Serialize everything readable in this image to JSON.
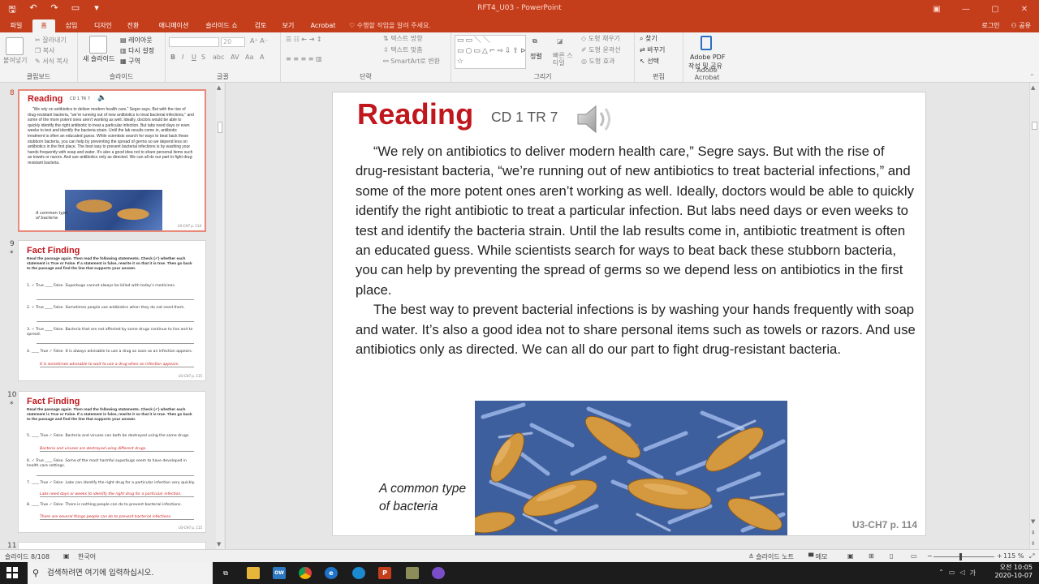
{
  "window": {
    "title": "RFT4_U03 - PowerPoint",
    "login": "로그인",
    "share": "공유"
  },
  "tabs": [
    "파일",
    "홈",
    "삽입",
    "디자인",
    "전환",
    "애니메이션",
    "슬라이드 쇼",
    "검토",
    "보기",
    "Acrobat"
  ],
  "tell_me": "수행할 작업을 알려 주세요.",
  "ribbon": {
    "clipboard": {
      "label": "클립보드",
      "paste": "붙여넣기",
      "cut": "잘라내기",
      "copy": "복사",
      "format_painter": "서식 복사"
    },
    "slides": {
      "label": "슬라이드",
      "new_slide": "새 슬라이드",
      "layout": "레이아웃",
      "reset": "다시 설정",
      "section": "구역"
    },
    "font": {
      "label": "글꼴",
      "size": "20"
    },
    "paragraph": {
      "label": "단락",
      "text_direction": "텍스트 방향",
      "align_text": "텍스트 맞춤",
      "smartart": "SmartArt로 변환"
    },
    "drawing": {
      "label": "그리기",
      "arrange": "정렬",
      "quick_styles": "빠른 스타일",
      "fill": "도형 채우기",
      "outline": "도형 윤곽선",
      "effects": "도형 효과"
    },
    "editing": {
      "label": "편집",
      "find": "찾기",
      "replace": "바꾸기",
      "select": "선택"
    },
    "acrobat": {
      "label": "Adobe Acrobat",
      "create_share_1": "Adobe PDF",
      "create_share_2": "작성 및 공유"
    }
  },
  "thumbnails": [
    {
      "number": "8",
      "title": "Reading",
      "cd": "CD 1 TR 7",
      "text": "“We rely on antibiotics to deliver modern health care,” Segre says. But with the rise of drug-resistant bacteria, “we’re running out of new antibiotics to treat bacterial infections,” and some of the more potent ones aren’t working as well. Ideally, doctors would be able to quickly identify the right antibiotic to treat a particular infection. But labs need days or even weeks to test and identify the bacteria strain. Until the lab results come in, antibiotic treatment is often an educated guess. While scientists search for ways to beat back these stubborn bacteria, you can help by preventing the spread of germs so we depend less on antibiotics in the first place. The best way to prevent bacterial infections is by washing your hands frequently with soap and water. It’s also a good idea not to share personal items such as towels or razors. And use antibiotics only as directed. We can all do our part to fight drug-resistant bacteria.",
      "caption": "A common type of bacteria",
      "page": "U3-CH7 p. 114"
    },
    {
      "number": "9",
      "title": "Fact Finding",
      "instructions": "Read the passage again. Then read the following statements. Check (✓) whether each statement is True or False. If a statement is false, rewrite it so that it is true. Then go back to the passage and find the line that supports your answer.",
      "items": [
        {
          "num": "1.",
          "tf": "✓ True ____ False",
          "text": "Superbugs cannot always be killed with today's medicines."
        },
        {
          "num": "2.",
          "tf": "✓ True ____ False",
          "text": "Sometimes people use antibiotics when they do not need them."
        },
        {
          "num": "3.",
          "tf": "✓ True ____ False",
          "text": "Bacteria that are not affected by some drugs continue to live and to spread."
        },
        {
          "num": "4.",
          "tf": "____ True ✓ False",
          "text": "It is always advisable to use a drug as soon as an infection appears."
        }
      ],
      "correction": "It is sometimes advisable to wait to use a drug when an infection appears.",
      "page": "U3-CH7 p. 115"
    },
    {
      "number": "10",
      "title": "Fact Finding",
      "instructions": "Read the passage again. Then read the following statements. Check (✓) whether each statement is True or False. If a statement is false, rewrite it so that it is true. Then go back to the passage and find the line that supports your answer.",
      "items": [
        {
          "num": "5.",
          "tf": "____ True ✓ False",
          "text": "Bacteria and viruses can both be destroyed using the same drugs.",
          "correction": "Bacteria and viruses are destroyed using different drugs."
        },
        {
          "num": "6.",
          "tf": "✓ True ____ False",
          "text": "Some of the most harmful superbugs seem to have developed in health care settings.",
          "correction": ""
        },
        {
          "num": "7.",
          "tf": "____ True ✓ False",
          "text": "Labs can identify the right drug for a particular infection very quickly.",
          "correction": "Labs need days or weeks to identify the right drug for a particular infection."
        },
        {
          "num": "8.",
          "tf": "____ True ✓ False",
          "text": "There is nothing people can do to prevent bacterial infections.",
          "correction": "There are several things people can do to prevent bacterial infections."
        }
      ],
      "page": "U3-CH7 p. 115"
    },
    {
      "number": "11"
    }
  ],
  "slide": {
    "title": "Reading",
    "cd": "CD 1 TR 7",
    "paragraphs": [
      "“We rely on antibiotics to deliver modern health care,” Segre says. But with the rise of drug-resistant bacteria, “we’re running out of new antibiotics to treat bacterial infections,” and some of the more potent ones aren’t working as well. Ideally, doctors would be able to quickly identify the right antibiotic to treat a particular infection. But labs need days or even weeks to test and identify the bacteria strain. Until the lab results come in, antibiotic treatment is often an educated guess. While scientists search for ways to beat back these stubborn bacteria, you can help by preventing the spread of germs so we depend less on antibiotics in the first place.",
      "The best way to prevent bacterial infections is by washing your hands frequently with soap and water. It’s also a good idea not to share personal items such as towels or razors. And use antibiotics only as directed. We can all do our part to fight drug-resistant bacteria."
    ],
    "caption_line1": "A common type",
    "caption_line2": "of bacteria",
    "page": "U3-CH7 p. 114"
  },
  "status": {
    "slide_count": "슬라이드 8/108",
    "language": "한국어",
    "notes": "슬라이드 노트",
    "comments": "메모",
    "zoom": "115 %"
  },
  "taskbar": {
    "search_placeholder": "검색하려면 여기에 입력하십시오.",
    "time": "오전 10:05",
    "date": "2020-10-07",
    "ime": "가"
  },
  "colors": {
    "brand": "#c43e1c",
    "title_red": "#c0171d"
  }
}
